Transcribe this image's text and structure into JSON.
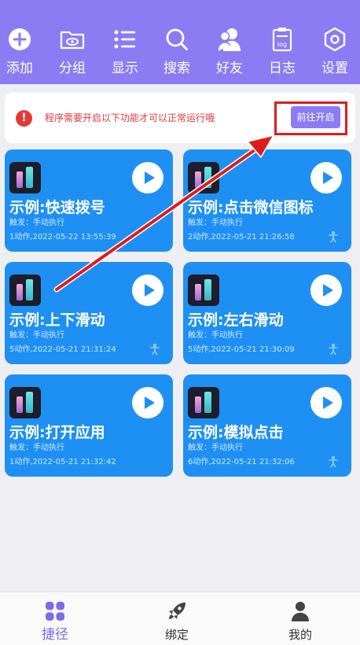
{
  "toolbar": {
    "items": [
      {
        "label": "添加",
        "icon": "add-circle-icon"
      },
      {
        "label": "分组",
        "icon": "folder-eye-icon"
      },
      {
        "label": "显示",
        "icon": "list-icon"
      },
      {
        "label": "搜索",
        "icon": "search-icon"
      },
      {
        "label": "好友",
        "icon": "friends-icon"
      },
      {
        "label": "日志",
        "icon": "log-icon"
      },
      {
        "label": "设置",
        "icon": "settings-icon"
      }
    ],
    "log_icon_text": "log"
  },
  "notice": {
    "warn_glyph": "!",
    "message": "程序需要开启以下功能才可以正常运行哦",
    "button_label": "前往开启"
  },
  "cards": [
    {
      "title": "示例:快速拨号",
      "trigger": "触发：手动执行",
      "meta": "1动作,2022-05-22 13:55:39",
      "has_person_icon": false
    },
    {
      "title": "示例:点击微信图标",
      "trigger": "触发：手动执行",
      "meta": "2动作,2022-05-21 21:26:58",
      "has_person_icon": true
    },
    {
      "title": "示例:上下滑动",
      "trigger": "触发：手动执行",
      "meta": "5动作,2022-05-21 21:31:24",
      "has_person_icon": true
    },
    {
      "title": "示例:左右滑动",
      "trigger": "触发：手动执行",
      "meta": "5动作,2022-05-21 21:30:09",
      "has_person_icon": true
    },
    {
      "title": "示例:打开应用",
      "trigger": "触发：手动执行",
      "meta": "1动作,2022-05-21 21:32:42",
      "has_person_icon": false
    },
    {
      "title": "示例:模拟点击",
      "trigger": "触发：手动执行",
      "meta": "6动作,2022-05-21 21:32:06",
      "has_person_icon": true
    }
  ],
  "bottom_nav": {
    "items": [
      {
        "label": "捷径",
        "icon": "shortcut-grid-icon",
        "active": true
      },
      {
        "label": "绑定",
        "icon": "rocket-icon",
        "active": false
      },
      {
        "label": "我的",
        "icon": "user-icon",
        "active": false
      }
    ]
  },
  "colors": {
    "primary": "#8b7cf4",
    "card": "#1e90f3",
    "warning": "#e5383b",
    "annotation": "#e01b1b"
  }
}
